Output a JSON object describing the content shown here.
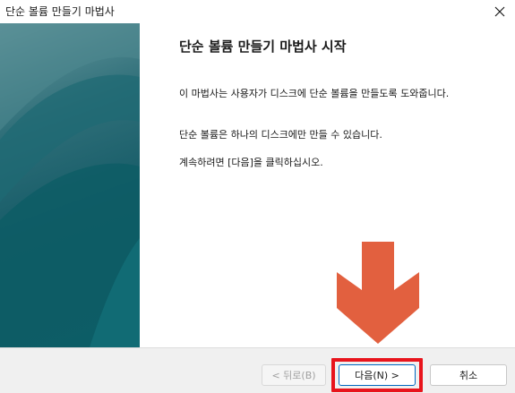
{
  "window": {
    "title": "단순 볼륨 만들기 마법사",
    "close_label": "×"
  },
  "main": {
    "heading": "단순 볼륨 만들기 마법사 시작",
    "paragraphs": [
      "이 마법사는 사용자가 디스크에 단순 볼륨을 만들도록 도와줍니다.",
      "단순 볼륨은 하나의 디스크에만 만들 수 있습니다.",
      "계속하려면 [다음]을 클릭하십시오."
    ]
  },
  "buttons": {
    "back": "< 뒤로(B)",
    "next": "다음(N) >",
    "cancel": "취소"
  },
  "annotation": {
    "arrow_color": "#e2603f",
    "highlight_color": "#e8141c"
  }
}
